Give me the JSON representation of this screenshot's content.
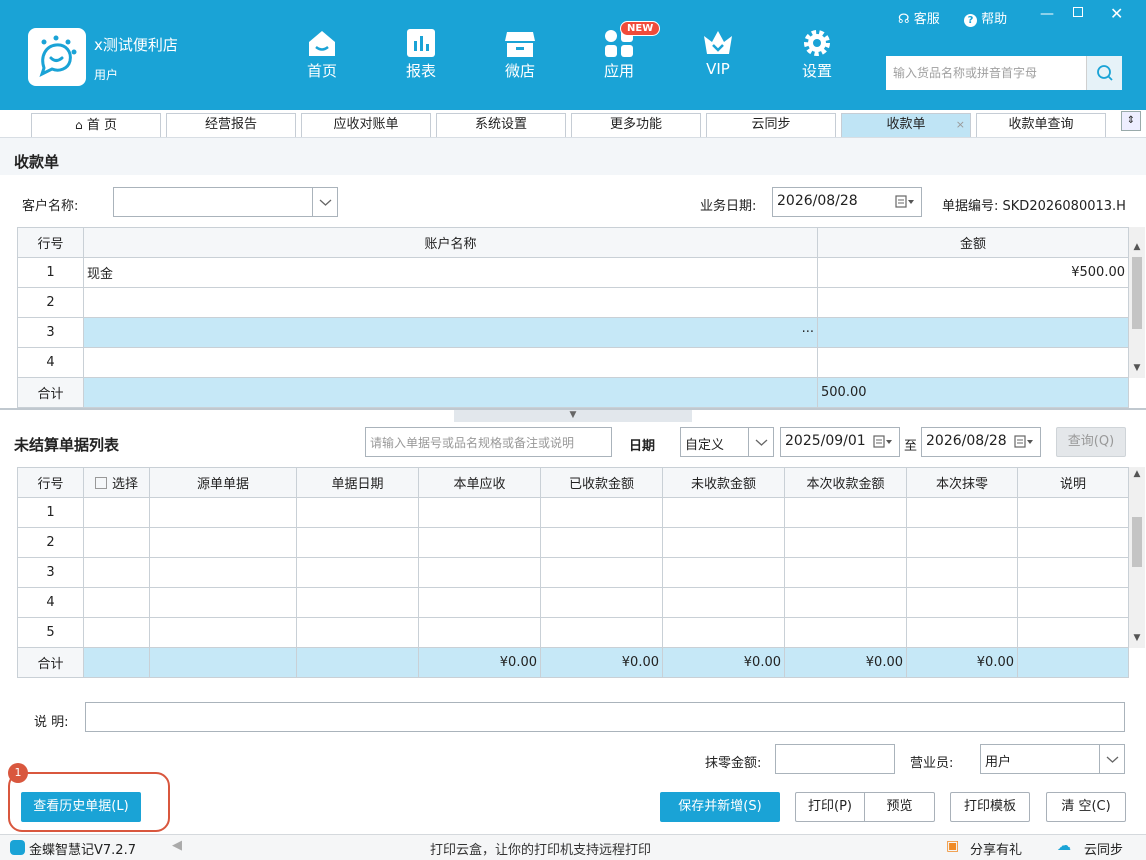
{
  "header": {
    "store_name": "x测试便利店",
    "store_user": "用户",
    "nav": [
      {
        "label": "首页",
        "icon": "home-icon"
      },
      {
        "label": "报表",
        "icon": "report-icon"
      },
      {
        "label": "微店",
        "icon": "shop-icon"
      },
      {
        "label": "应用",
        "icon": "apps-icon"
      },
      {
        "label": "VIP",
        "icon": "vip-icon"
      },
      {
        "label": "设置",
        "icon": "gear-icon"
      }
    ],
    "new_badge": "NEW",
    "service": "客服",
    "help": "帮助",
    "search_placeholder": "输入货品名称或拼音首字母"
  },
  "tabs": [
    {
      "label": "首 页",
      "icon": "home-icon"
    },
    {
      "label": "经营报告"
    },
    {
      "label": "应收对账单"
    },
    {
      "label": "系统设置"
    },
    {
      "label": "更多功能"
    },
    {
      "label": "云同步"
    },
    {
      "label": "收款单",
      "active": true,
      "close": "×"
    },
    {
      "label": "收款单查询"
    }
  ],
  "receipt": {
    "title": "收款单",
    "customer_label": "客户名称:",
    "customer_value": "",
    "date_label": "业务日期:",
    "date_value": "2026/08/28",
    "number_label": "单据编号:",
    "number_value": "SKD2026080013.H",
    "columns": [
      "行号",
      "账户名称",
      "金额"
    ],
    "rows": [
      {
        "no": "1",
        "account": "现金",
        "amount": "¥500.00"
      },
      {
        "no": "2",
        "account": "",
        "amount": ""
      },
      {
        "no": "3",
        "account": "",
        "amount": "",
        "ellipsis": "···"
      },
      {
        "no": "4",
        "account": "",
        "amount": ""
      }
    ],
    "total_label": "合计",
    "total_amount": "500.00"
  },
  "unsettled": {
    "title": "未结算单据列表",
    "search_placeholder": "请输入单据号或品名规格或备注或说明",
    "date_label": "日期",
    "date_mode": "自定义",
    "date_from": "2025/09/01",
    "date_to_label": "至",
    "date_to": "2026/08/28",
    "query_button": "查询(Q)",
    "columns": [
      "行号",
      "选择",
      "源单单据",
      "单据日期",
      "本单应收",
      "已收款金额",
      "未收款金额",
      "本次收款金额",
      "本次抹零",
      "说明"
    ],
    "rows": [
      "1",
      "2",
      "3",
      "4",
      "5"
    ],
    "total_label": "合计",
    "totals": [
      "¥0.00",
      "¥0.00",
      "¥0.00",
      "¥0.00",
      "¥0.00"
    ]
  },
  "footer_form": {
    "note_label": "说 明:",
    "note_value": "",
    "rounding_label": "抹零金额:",
    "rounding_value": "",
    "staff_label": "营业员:",
    "staff_value": "用户"
  },
  "buttons": {
    "history": "查看历史单据(L)",
    "history_badge": "1",
    "save_new": "保存并新增(S)",
    "print": "打印(P)",
    "preview": "预览",
    "print_template": "打印模板",
    "clear": "清 空(C)"
  },
  "status": {
    "version": "金蝶智慧记V7.2.7",
    "message": "打印云盒，让你的打印机支持远程打印",
    "share": "分享有礼",
    "sync": "云同步"
  },
  "colors": {
    "brand": "#1aa3d6",
    "highlight_row": "#c6e8f7",
    "badge_red": "#f04b3a",
    "annotation": "#d9573e"
  }
}
